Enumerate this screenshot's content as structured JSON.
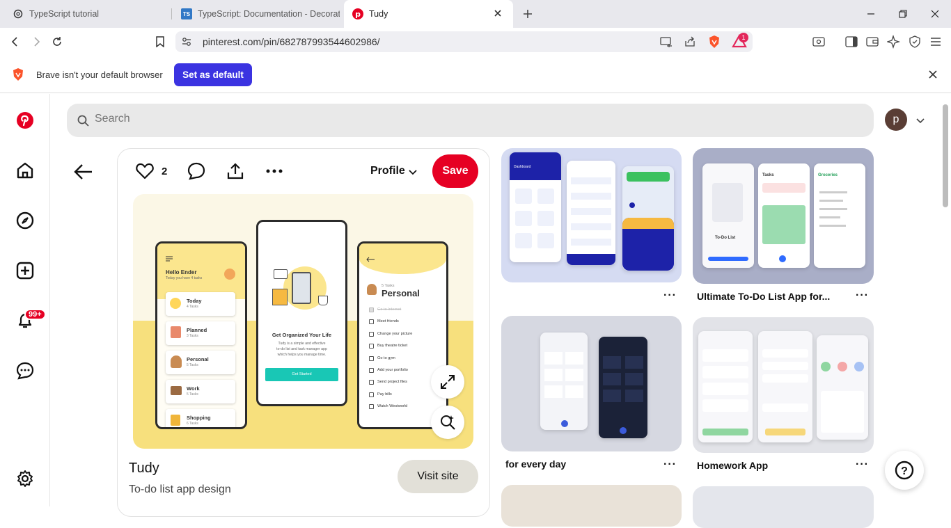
{
  "browser": {
    "tabs": [
      {
        "title": "TypeScript tutorial",
        "icon": "openai-icon",
        "active": false
      },
      {
        "title": "TypeScript: Documentation - Decorat",
        "icon": "typescript-icon",
        "active": false
      },
      {
        "title": "Tudy",
        "icon": "pinterest-icon",
        "active": true
      }
    ],
    "typescript_icon_text": "TS",
    "url": "pinterest.com/pin/682787993544602986/",
    "rewards_badge": "1",
    "infobar": {
      "message": "Brave isn't your default browser",
      "button": "Set as default"
    }
  },
  "pinterest": {
    "search_placeholder": "Search",
    "avatar_letter": "p",
    "notification_badge": "99+",
    "pin": {
      "likes": "2",
      "profile_label": "Profile",
      "save_label": "Save",
      "title": "Tudy",
      "description": "To-do list app design",
      "visit_label": "Visit site"
    },
    "pin_image": {
      "phone1": {
        "greeting": "Hello Ender",
        "subtitle": "Today you have 4 tasks",
        "cards": [
          {
            "name": "Today",
            "count": "4 Tasks"
          },
          {
            "name": "Planned",
            "count": "3 Tasks"
          },
          {
            "name": "Personal",
            "count": "5 Tasks"
          },
          {
            "name": "Work",
            "count": "5 Tasks"
          },
          {
            "name": "Shopping",
            "count": "6 Tasks"
          }
        ]
      },
      "phone2": {
        "heading": "Get Organized Your Life",
        "body": [
          "Tudy is a simple and effective",
          "to-do list and task manager app",
          "which helps you manage time."
        ],
        "button": "Get Started"
      },
      "phone3": {
        "count": "5 Tasks",
        "heading": "Personal",
        "items": [
          "Go to Internet",
          "Meet friends",
          "Change your picture",
          "Buy theatre ticket",
          "Go to gym",
          "Add your portfolio",
          "Send project files",
          "Pay bills",
          "Watch Westworld"
        ]
      }
    },
    "related": [
      {
        "title": ""
      },
      {
        "title": "Ultimate To-Do List App for..."
      },
      {
        "title": "for every day"
      },
      {
        "title": "Homework App"
      }
    ],
    "related_mock_text": {
      "todo_list": "To-Do List",
      "tasks": "Tasks",
      "groceries": "Groceries",
      "dashboard": "Dashboard"
    },
    "more_label": "···",
    "help_label": "?"
  }
}
